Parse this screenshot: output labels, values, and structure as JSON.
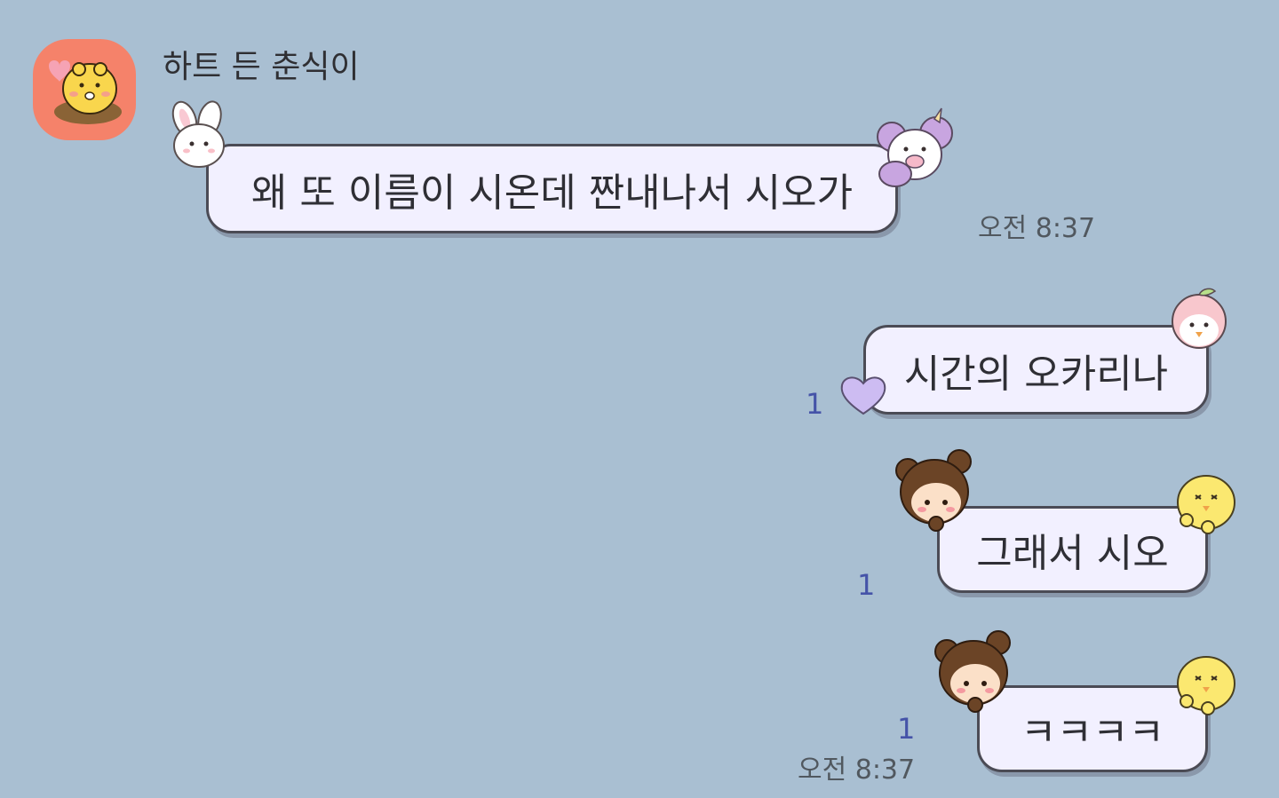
{
  "chat": {
    "sender_name": "하트 든 춘식이",
    "messages": [
      {
        "text": "왜 또 이름이 시온데 짠내나서 시오가",
        "side": "left"
      },
      {
        "text": "시간의 오카리나",
        "side": "right",
        "unread": "1"
      },
      {
        "text": "그래서 시오",
        "side": "right",
        "unread": "1"
      },
      {
        "text": "ㅋㅋㅋㅋ",
        "side": "right",
        "unread": "1"
      }
    ],
    "timestamps": [
      "오전 8:37",
      "오전 8:37"
    ]
  },
  "icons": {
    "avatar": "chunsik-holding-heart-avatar",
    "stickers": [
      "bunny-sticker",
      "unicorn-sticker",
      "peach-bird-sticker",
      "heart-sticker",
      "bear-girl-sticker",
      "chick-sticker"
    ]
  },
  "colors": {
    "background": "#a9bfd2",
    "bubble_fill": "#f2f0ff",
    "bubble_border": "#4b4b55",
    "unread": "#4553a8",
    "avatar_bg": "#f5826a"
  }
}
